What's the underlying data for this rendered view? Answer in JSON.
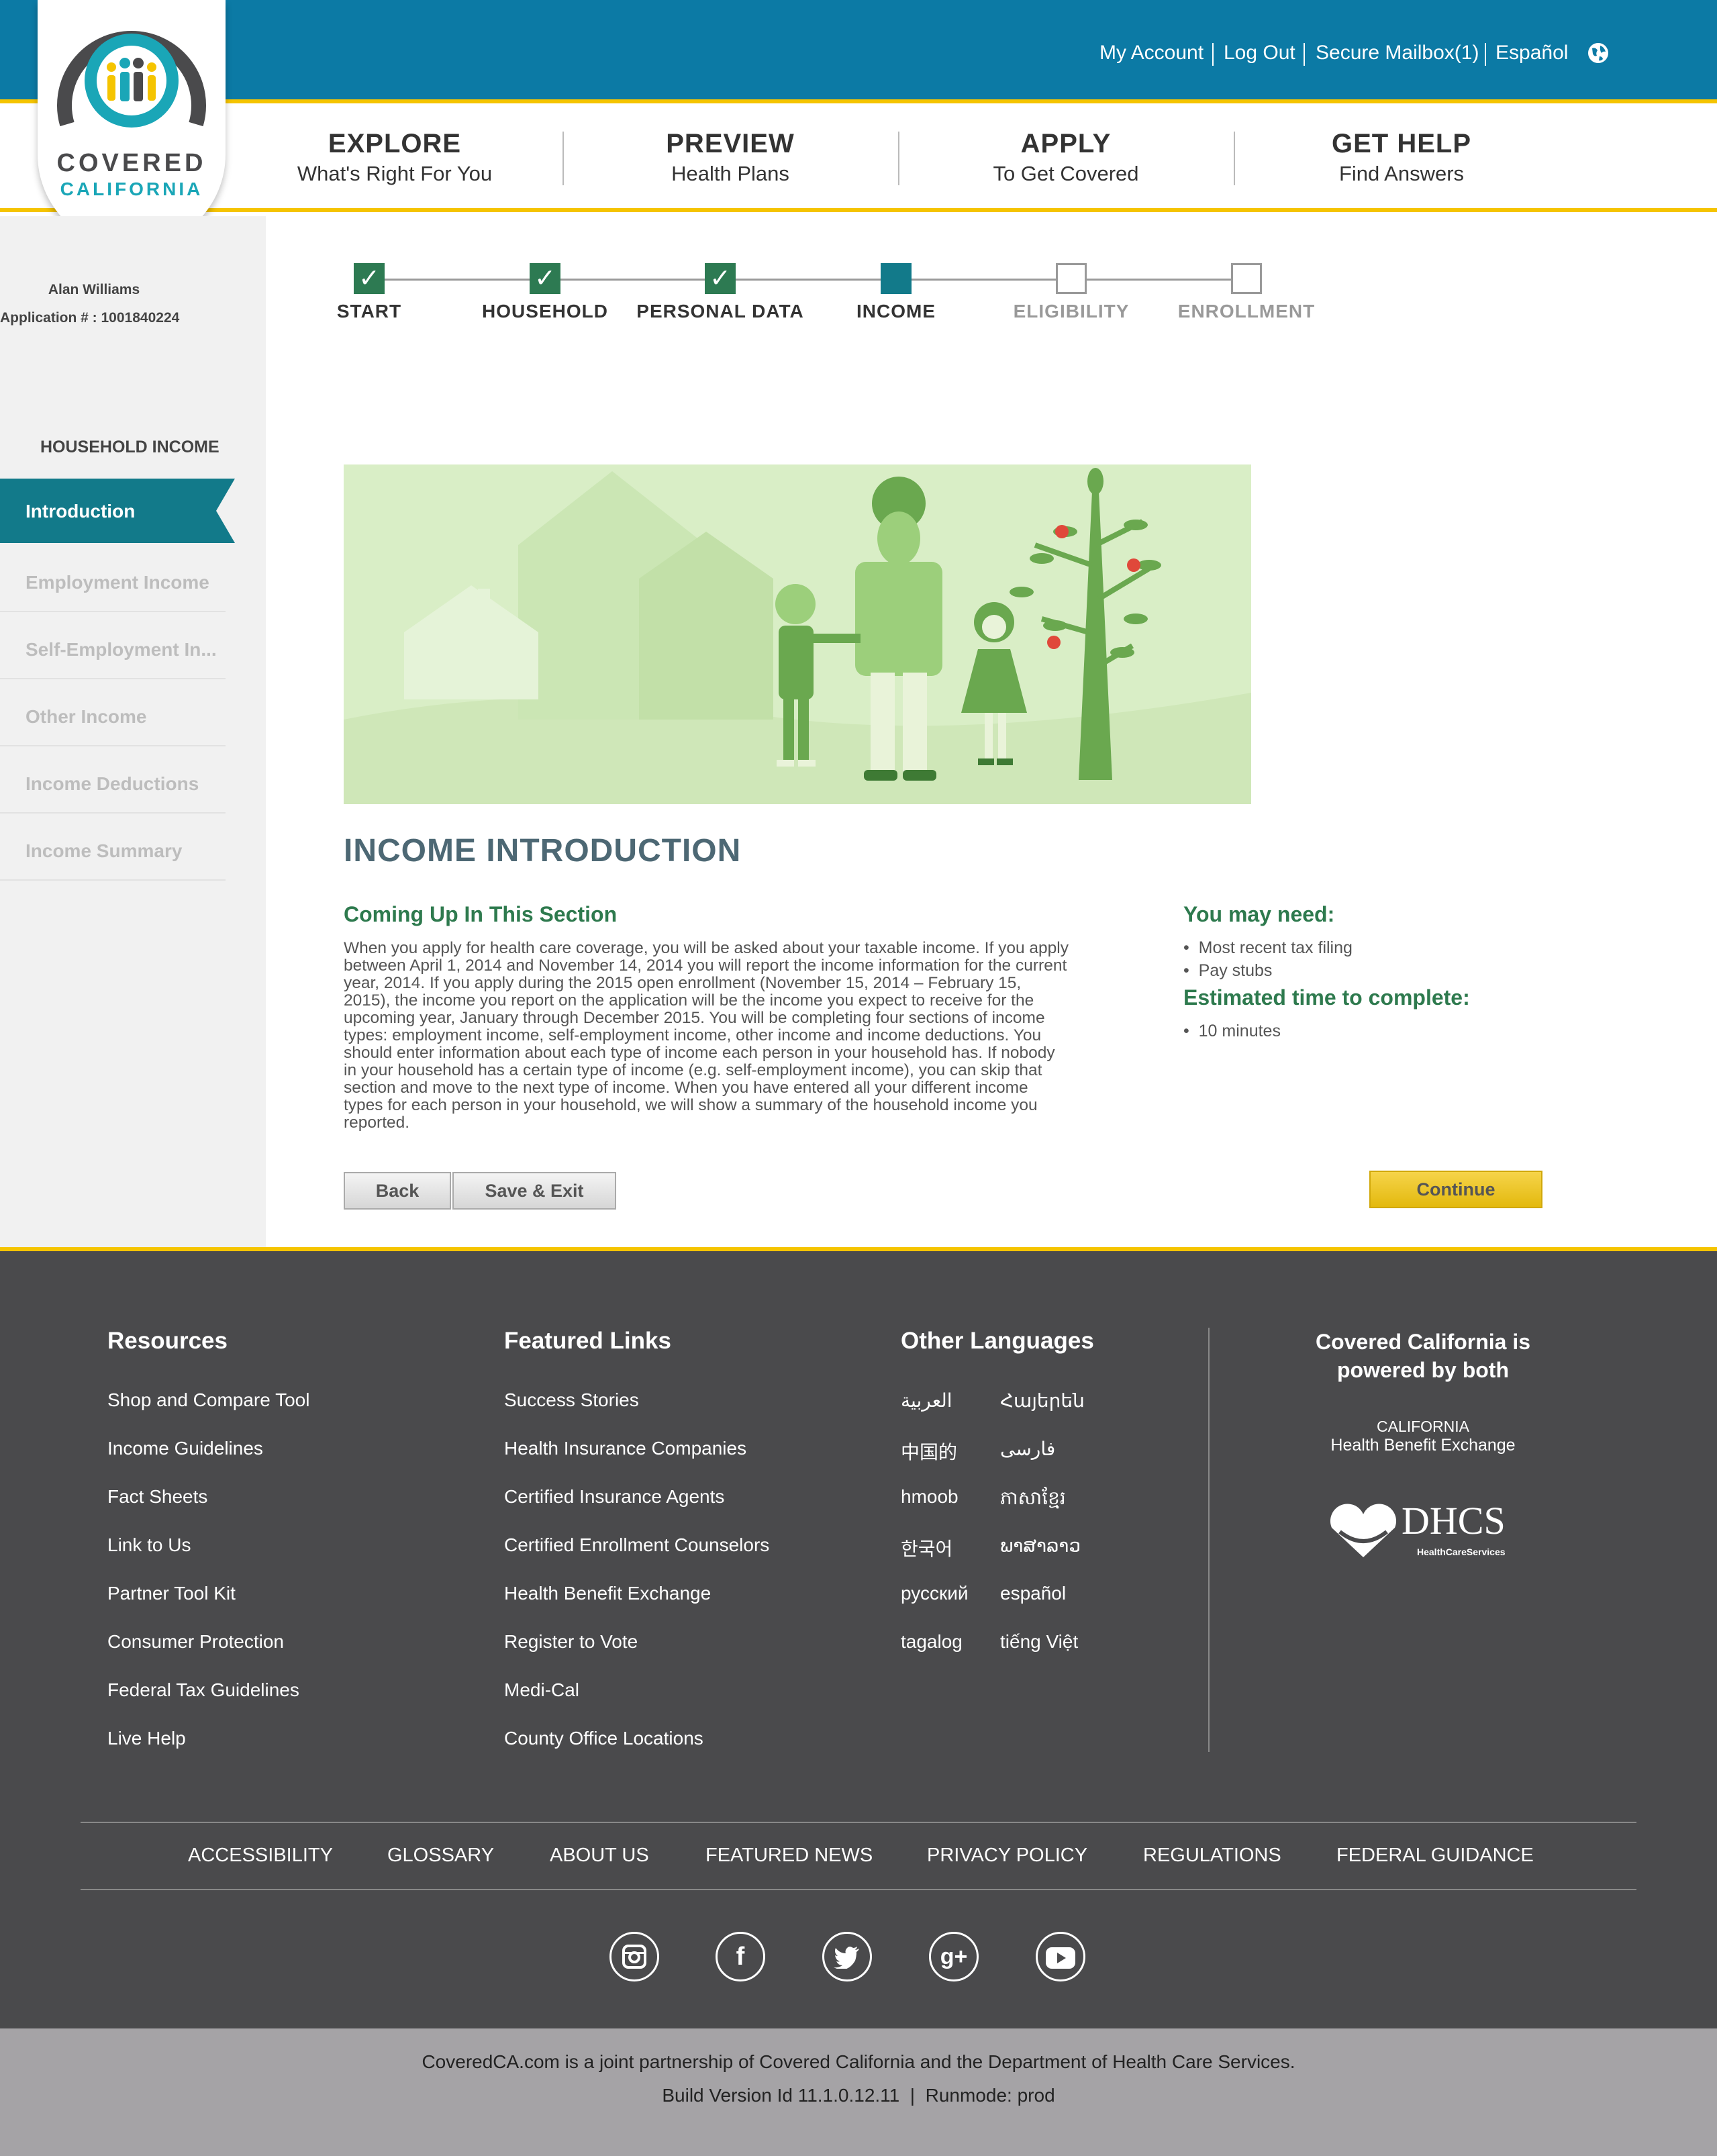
{
  "header": {
    "links": [
      "My Account",
      "Log Out",
      "Secure Mailbox(1)",
      "Español"
    ],
    "logo": {
      "line1": "COVERED",
      "line2": "CALIFORNIA"
    }
  },
  "nav": [
    {
      "title": "EXPLORE",
      "sub": "What's Right For You"
    },
    {
      "title": "PREVIEW",
      "sub": "Health Plans"
    },
    {
      "title": "APPLY",
      "sub": "To Get Covered"
    },
    {
      "title": "GET HELP",
      "sub": "Find Answers"
    }
  ],
  "user": {
    "name": "Alan Williams",
    "application": "Application # : 1001840224"
  },
  "sidebar": {
    "heading": "HOUSEHOLD INCOME",
    "items": [
      "Introduction",
      "Employment Income",
      "Self-Employment In...",
      "Other Income",
      "Income Deductions",
      "Income Summary"
    ],
    "active_index": 0
  },
  "progress": {
    "steps": [
      {
        "label": "START",
        "state": "done"
      },
      {
        "label": "HOUSEHOLD",
        "state": "done"
      },
      {
        "label": "PERSONAL DATA",
        "state": "done"
      },
      {
        "label": "INCOME",
        "state": "current"
      },
      {
        "label": "ELIGIBILITY",
        "state": "todo"
      },
      {
        "label": "ENROLLMENT",
        "state": "todo"
      }
    ],
    "check": "✓"
  },
  "main": {
    "title": "INCOME INTRODUCTION",
    "section_heading": "Coming Up In This Section",
    "body": "When you apply for health care coverage, you will be asked about your taxable income. If you apply between April 1, 2014 and November 14, 2014 you will report the income information for the current year, 2014. If you apply during the 2015 open enrollment (November 15, 2014 – February 15, 2015), the income you report on the application will be the income you expect to receive for the upcoming year, January through December 2015. You will be completing four sections of income types: employment income, self-employment income, other income and income deductions. You should enter information about each type of income each person in your household has. If nobody in your household has a certain type of income (e.g. self-employment income), you can skip that section and move to the next type of income. When you have entered all your different income types for each person in your household, we will show a summary of the household income you reported.",
    "need_heading": "You may need:",
    "need_items": [
      "Most recent tax filing",
      "Pay stubs"
    ],
    "time_heading": "Estimated time to complete:",
    "time_items": [
      "10 minutes"
    ],
    "buttons": {
      "back": "Back",
      "save": "Save & Exit",
      "continue": "Continue"
    }
  },
  "footer": {
    "resources": {
      "heading": "Resources",
      "links": [
        "Shop and Compare Tool",
        "Income Guidelines",
        "Fact Sheets",
        "Link to Us",
        "Partner Tool Kit",
        "Consumer Protection",
        "Federal Tax Guidelines",
        "Live Help"
      ]
    },
    "featured": {
      "heading": "Featured Links",
      "links": [
        "Success Stories",
        "Health Insurance Companies",
        "Certified Insurance Agents",
        "Certified Enrollment Counselors",
        "Health Benefit Exchange",
        "Register to Vote",
        "Medi-Cal",
        "County Office Locations"
      ]
    },
    "languages": {
      "heading": "Other Languages",
      "left": [
        "العربية",
        "中国的",
        "hmoob",
        "한국어",
        "русский",
        "tagalog"
      ],
      "right": [
        "Հայերեն",
        "فارسی",
        "ភាសាខ្មែរ",
        "ພາສາລາວ",
        "español",
        "tiếng Việt"
      ]
    },
    "powered": {
      "heading": "Covered California is powered by both",
      "hbex_top": "CALIFORNIA",
      "hbex_bottom": "Health Benefit Exchange",
      "dhcs": "DHCS",
      "dhcs_sub": "HealthCareServices"
    },
    "bottom_links": [
      "ACCESSIBILITY",
      "GLOSSARY",
      "ABOUT US",
      "FEATURED NEWS",
      "PRIVACY POLICY",
      "REGULATIONS",
      "FEDERAL GUIDANCE"
    ],
    "social": [
      "instagram-icon",
      "facebook-icon",
      "twitter-icon",
      "google-plus-icon",
      "youtube-icon"
    ],
    "copy1": "CoveredCA.com is a joint partnership of Covered California and the Department of Health Care Services.",
    "copy2": "Build Version Id 11.1.0.12.11  |  Runmode: prod"
  }
}
